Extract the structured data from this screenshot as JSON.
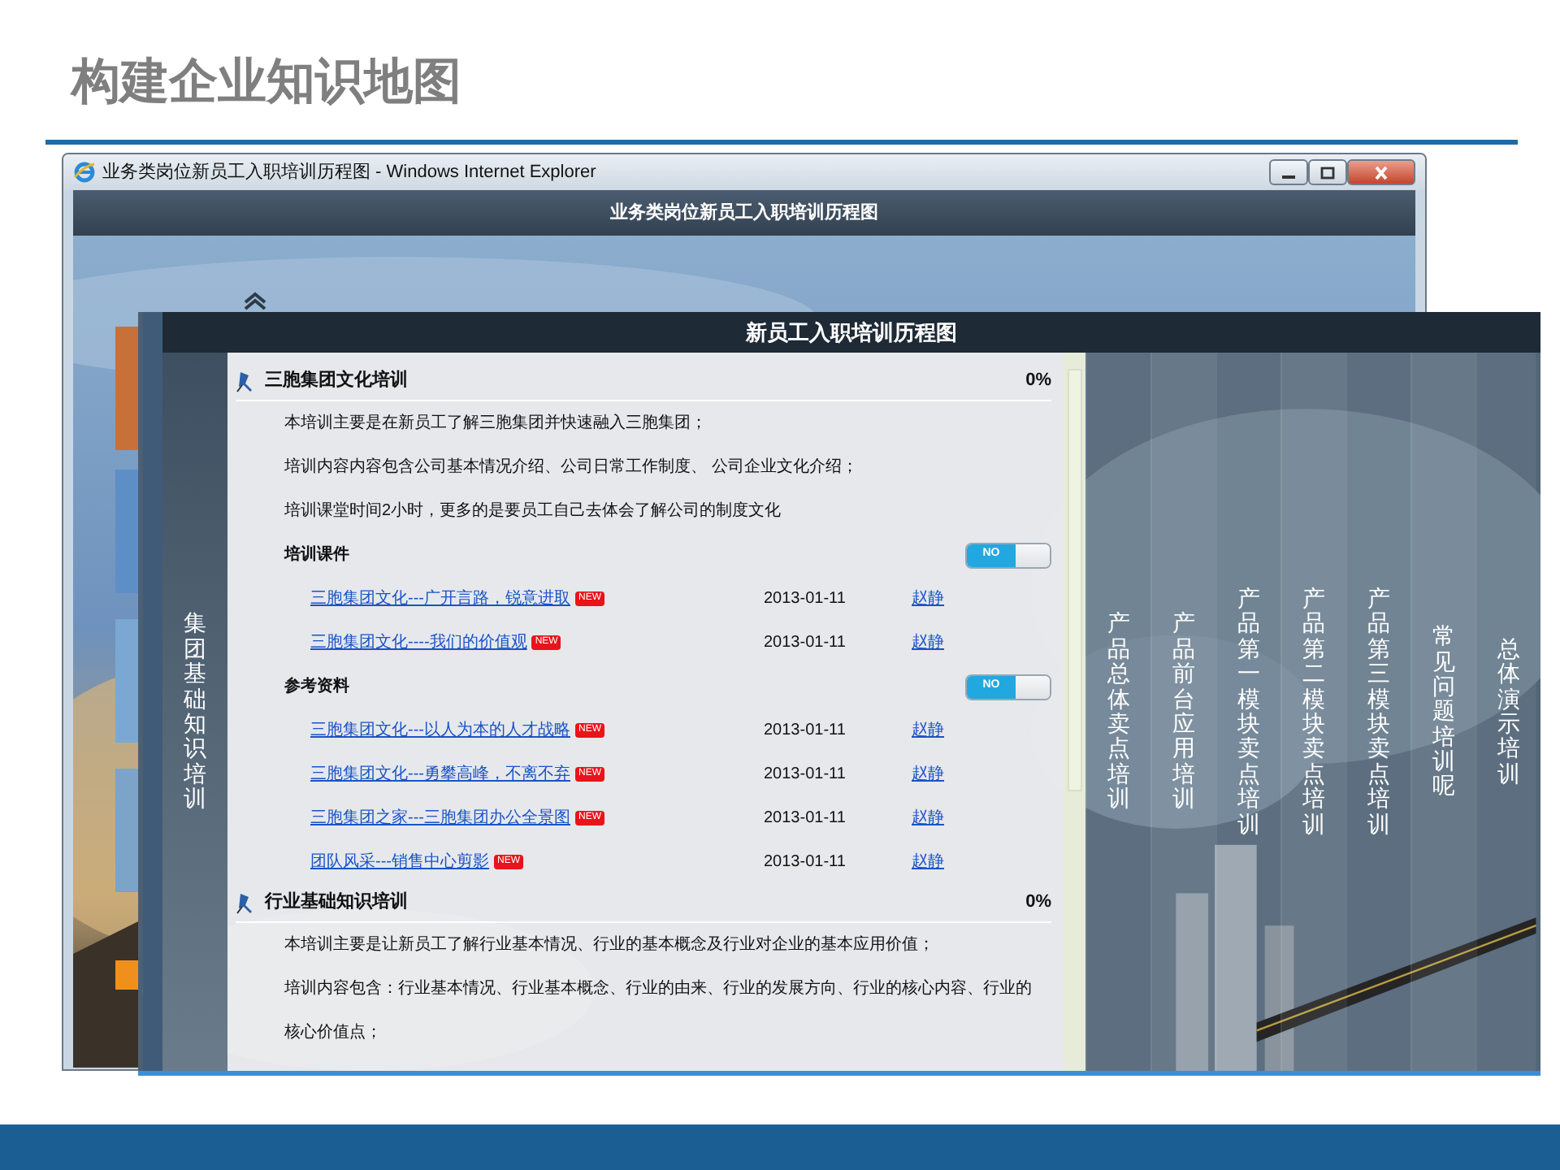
{
  "slide": {
    "title": "构建企业知识地图"
  },
  "browser": {
    "title": "业务类岗位新员工入职培训历程图 - Windows Internet Explorer",
    "page_header": "业务类岗位新员工入职培训历程图"
  },
  "panel": {
    "title": "新员工入职培训历程图",
    "left_tab": "集团基础知识培训",
    "sections": [
      {
        "title": "三胞集团文化培训",
        "progress": "0%",
        "lines": [
          "本培训主要是在新员工了解三胞集团并快速融入三胞集团；",
          "培训内容内容包含公司基本情况介绍、公司日常工作制度、 公司企业文化介绍；",
          "培训课堂时间2小时，更多的是要员工自己去体会了解公司的制度文化"
        ],
        "groups": [
          {
            "title": "培训课件",
            "toggle": "NO",
            "on": false,
            "items": [
              {
                "title": "三胞集团文化---广开言路，锐意进取",
                "badge": "NEW",
                "date": "2013-01-11",
                "author": "赵静"
              },
              {
                "title": "三胞集团文化----我们的价值观",
                "badge": "NEW",
                "date": "2013-01-11",
                "author": "赵静"
              }
            ]
          },
          {
            "title": "参考资料",
            "toggle": "NO",
            "on": false,
            "items": [
              {
                "title": "三胞集团文化---以人为本的人才战略",
                "badge": "NEW",
                "date": "2013-01-11",
                "author": "赵静"
              },
              {
                "title": "三胞集团文化---勇攀高峰，不离不弃",
                "badge": "NEW",
                "date": "2013-01-11",
                "author": "赵静"
              },
              {
                "title": "三胞集团之家---三胞集团办公全景图",
                "badge": "NEW",
                "date": "2013-01-11",
                "author": "赵静"
              },
              {
                "title": "团队风采---销售中心剪影",
                "badge": "NEW",
                "date": "2013-01-11",
                "author": "赵静"
              }
            ]
          }
        ]
      },
      {
        "title": "行业基础知识培训",
        "progress": "0%",
        "lines": [
          "本培训主要是让新员工了解行业基本情况、行业的基本概念及行业对企业的基本应用价值；",
          "培训内容包含：行业基本情况、行业基本概念、行业的由来、行业的发展方向、行业的核心内容、行业的核心价值点；"
        ]
      }
    ],
    "right_tabs": [
      "产品总体卖点培训",
      "产品前台应用培训",
      "产品第一模块卖点培训",
      "产品第二模块卖点培训",
      "产品第三模块卖点培训",
      "常见问题培训呢",
      "总体演示培训"
    ]
  }
}
